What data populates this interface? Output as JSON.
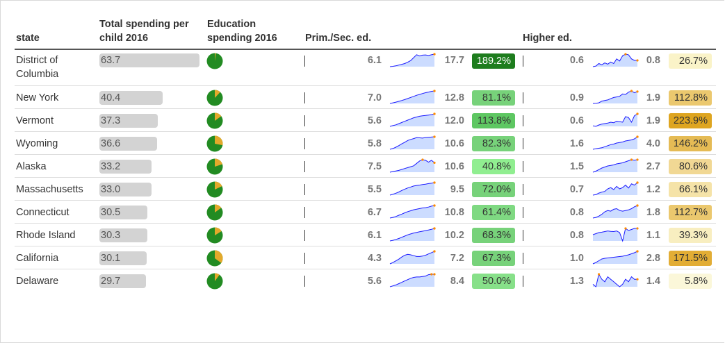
{
  "headers": {
    "state": "state",
    "total_spending_line1": "Total spending per",
    "total_spending_line2": "child 2016",
    "edu_spending_line1": "Education",
    "edu_spending_line2": "spending 2016",
    "prim_sec": "Prim./Sec. ed.",
    "higher": "Higher ed."
  },
  "colors": {
    "bar": "#d3d3d3",
    "pie_main": "#228b22",
    "pie_slice": "#e3a92b",
    "spark_line": "#1a1aff",
    "spark_fill": "#ccdcff",
    "spark_dot": "#ff8c00"
  },
  "rows": [
    {
      "state_l1": "District of",
      "state_l2": "Columbia",
      "total": "63.7",
      "total_num": 63.7,
      "pie_frac": 0.02,
      "ps_start": "6.1",
      "ps_end": "17.7",
      "ps_pct": "189.2%",
      "ps_color": "#1e7d1e",
      "ps_text": "#ffffff",
      "ps_spark": [
        6.1,
        6.4,
        6.9,
        7.6,
        8.3,
        9.0,
        10.2,
        11.8,
        14.5,
        17.2,
        16.0,
        16.8,
        17.0,
        16.5,
        17.1,
        17.7
      ],
      "he_start": "0.6",
      "he_end": "0.8",
      "he_pct": "26.7%",
      "he_color": "#faf3c8",
      "he_spark": [
        0.6,
        0.62,
        0.7,
        0.66,
        0.72,
        0.68,
        0.75,
        0.7,
        0.85,
        0.78,
        0.95,
        1.0,
        0.98,
        0.85,
        0.8,
        0.8
      ]
    },
    {
      "state_l1": "New York",
      "state_l2": "",
      "total": "40.4",
      "total_num": 40.4,
      "pie_frac": 0.12,
      "ps_start": "7.0",
      "ps_end": "12.8",
      "ps_pct": "81.1%",
      "ps_color": "#77d27a",
      "ps_text": "#333333",
      "ps_spark": [
        7.0,
        7.3,
        7.6,
        8.0,
        8.4,
        8.8,
        9.3,
        9.8,
        10.3,
        10.8,
        11.2,
        11.6,
        12.0,
        12.3,
        12.6,
        12.8
      ],
      "he_start": "0.9",
      "he_end": "1.9",
      "he_pct": "112.8%",
      "he_color": "#ebc86e",
      "he_spark": [
        0.9,
        0.92,
        0.95,
        1.1,
        1.15,
        1.2,
        1.3,
        1.4,
        1.45,
        1.5,
        1.7,
        1.65,
        1.85,
        1.95,
        1.8,
        1.9
      ]
    },
    {
      "state_l1": "Vermont",
      "state_l2": "",
      "total": "37.3",
      "total_num": 37.3,
      "pie_frac": 0.15,
      "ps_start": "5.6",
      "ps_end": "12.0",
      "ps_pct": "113.8%",
      "ps_color": "#5ec762",
      "ps_text": "#333333",
      "ps_spark": [
        5.6,
        6.0,
        6.4,
        7.0,
        7.6,
        8.2,
        8.8,
        9.4,
        10.0,
        10.4,
        10.8,
        11.0,
        11.2,
        11.4,
        11.6,
        12.0
      ],
      "he_start": "0.6",
      "he_end": "1.9",
      "he_pct": "223.9%",
      "he_color": "#dea520",
      "he_spark": [
        0.6,
        0.55,
        0.7,
        0.8,
        0.85,
        0.9,
        1.0,
        0.95,
        1.1,
        1.05,
        1.0,
        1.6,
        1.5,
        1.0,
        1.7,
        1.9
      ]
    },
    {
      "state_l1": "Wyoming",
      "state_l2": "",
      "total": "36.6",
      "total_num": 36.6,
      "pie_frac": 0.28,
      "ps_start": "5.8",
      "ps_end": "10.6",
      "ps_pct": "82.3%",
      "ps_color": "#77d27a",
      "ps_text": "#333333",
      "ps_spark": [
        5.8,
        6.1,
        6.6,
        7.2,
        7.9,
        8.5,
        9.2,
        9.6,
        9.9,
        10.3,
        10.2,
        10.1,
        10.3,
        10.4,
        10.5,
        10.6
      ],
      "he_start": "1.6",
      "he_end": "4.0",
      "he_pct": "146.2%",
      "he_color": "#e5bb55",
      "he_spark": [
        1.6,
        1.7,
        1.8,
        1.9,
        2.1,
        2.3,
        2.5,
        2.6,
        2.8,
        2.9,
        3.0,
        3.2,
        3.3,
        3.4,
        3.6,
        4.0
      ]
    },
    {
      "state_l1": "Alaska",
      "state_l2": "",
      "total": "33.2",
      "total_num": 33.2,
      "pie_frac": 0.2,
      "ps_start": "7.5",
      "ps_end": "10.6",
      "ps_pct": "40.8%",
      "ps_color": "#90ee90",
      "ps_text": "#333333",
      "ps_spark": [
        7.5,
        7.7,
        7.9,
        8.1,
        8.4,
        8.7,
        9.0,
        9.3,
        9.6,
        10.4,
        11.2,
        11.6,
        11.4,
        10.8,
        11.4,
        10.6
      ],
      "he_start": "1.5",
      "he_end": "2.7",
      "he_pct": "80.6%",
      "he_color": "#f1d894",
      "he_spark": [
        1.5,
        1.6,
        1.75,
        1.9,
        2.0,
        2.1,
        2.15,
        2.2,
        2.3,
        2.35,
        2.4,
        2.5,
        2.6,
        2.7,
        2.65,
        2.7
      ]
    },
    {
      "state_l1": "Massachusetts",
      "state_l2": "",
      "total": "33.0",
      "total_num": 33.0,
      "pie_frac": 0.18,
      "ps_start": "5.5",
      "ps_end": "9.5",
      "ps_pct": "72.0%",
      "ps_color": "#77d27a",
      "ps_text": "#333333",
      "ps_spark": [
        5.5,
        5.8,
        6.1,
        6.5,
        7.0,
        7.4,
        7.8,
        8.1,
        8.4,
        8.6,
        8.7,
        8.9,
        9.0,
        9.2,
        9.3,
        9.5
      ],
      "he_start": "0.7",
      "he_end": "1.2",
      "he_pct": "66.1%",
      "he_color": "#f5e3a8",
      "he_spark": [
        0.7,
        0.72,
        0.78,
        0.82,
        0.85,
        0.95,
        1.0,
        0.92,
        1.05,
        0.95,
        1.0,
        1.1,
        0.98,
        1.15,
        1.1,
        1.2
      ]
    },
    {
      "state_l1": "Connecticut",
      "state_l2": "",
      "total": "30.5",
      "total_num": 30.5,
      "pie_frac": 0.15,
      "ps_start": "6.7",
      "ps_end": "10.8",
      "ps_pct": "61.4%",
      "ps_color": "#7fd982",
      "ps_text": "#333333",
      "ps_spark": [
        6.7,
        6.9,
        7.2,
        7.6,
        8.0,
        8.4,
        8.8,
        9.1,
        9.4,
        9.6,
        9.8,
        10.0,
        10.1,
        10.3,
        10.6,
        10.8
      ],
      "he_start": "0.8",
      "he_end": "1.8",
      "he_pct": "112.7%",
      "he_color": "#ebc86e",
      "he_spark": [
        0.8,
        0.85,
        0.95,
        1.1,
        1.3,
        1.4,
        1.35,
        1.5,
        1.55,
        1.4,
        1.35,
        1.4,
        1.45,
        1.55,
        1.7,
        1.8
      ]
    },
    {
      "state_l1": "Rhode Island",
      "state_l2": "",
      "total": "30.3",
      "total_num": 30.3,
      "pie_frac": 0.16,
      "ps_start": "6.1",
      "ps_end": "10.2",
      "ps_pct": "68.3%",
      "ps_color": "#77d27a",
      "ps_text": "#333333",
      "ps_spark": [
        6.1,
        6.3,
        6.6,
        6.9,
        7.3,
        7.7,
        8.1,
        8.4,
        8.7,
        8.9,
        9.1,
        9.3,
        9.5,
        9.7,
        9.9,
        10.2
      ],
      "he_start": "0.8",
      "he_end": "1.1",
      "he_pct": "39.3%",
      "he_color": "#f8eec0",
      "he_spark": [
        0.8,
        0.85,
        0.9,
        0.92,
        0.95,
        0.98,
        0.96,
        0.95,
        0.98,
        0.9,
        0.5,
        1.1,
        1.0,
        1.05,
        1.1,
        1.1
      ]
    },
    {
      "state_l1": "California",
      "state_l2": "",
      "total": "30.1",
      "total_num": 30.1,
      "pie_frac": 0.35,
      "ps_start": "4.3",
      "ps_end": "7.2",
      "ps_pct": "67.3%",
      "ps_color": "#77d27a",
      "ps_text": "#333333",
      "ps_spark": [
        4.3,
        4.6,
        5.0,
        5.4,
        5.9,
        6.3,
        6.5,
        6.4,
        6.2,
        6.0,
        6.0,
        6.1,
        6.3,
        6.6,
        6.9,
        7.2
      ],
      "he_start": "1.0",
      "he_end": "2.8",
      "he_pct": "171.5%",
      "he_color": "#e2ad35",
      "he_spark": [
        1.0,
        1.2,
        1.45,
        1.7,
        1.8,
        1.85,
        1.9,
        1.95,
        2.0,
        2.05,
        2.1,
        2.2,
        2.3,
        2.45,
        2.6,
        2.8
      ]
    },
    {
      "state_l1": "Delaware",
      "state_l2": "",
      "total": "29.7",
      "total_num": 29.7,
      "pie_frac": 0.1,
      "ps_start": "5.6",
      "ps_end": "8.4",
      "ps_pct": "50.0%",
      "ps_color": "#87e089",
      "ps_text": "#333333",
      "ps_spark": [
        5.6,
        5.8,
        6.0,
        6.3,
        6.6,
        6.9,
        7.2,
        7.5,
        7.7,
        7.8,
        7.8,
        7.9,
        8.0,
        8.3,
        8.4,
        8.4
      ],
      "he_start": "1.3",
      "he_end": "1.4",
      "he_pct": "5.8%",
      "he_color": "#fbf7d9",
      "he_spark": [
        1.3,
        1.25,
        1.5,
        1.4,
        1.35,
        1.45,
        1.4,
        1.35,
        1.3,
        1.25,
        1.3,
        1.4,
        1.35,
        1.45,
        1.4,
        1.4
      ]
    }
  ]
}
